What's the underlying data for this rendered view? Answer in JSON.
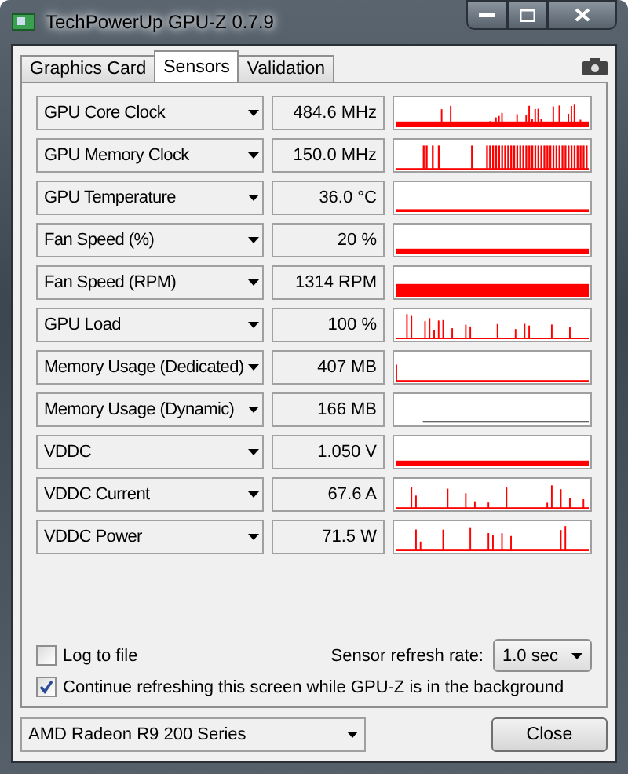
{
  "window": {
    "title": "TechPowerUp GPU-Z 0.7.9"
  },
  "tabs": [
    {
      "label": "Graphics Card",
      "selected": false
    },
    {
      "label": "Sensors",
      "selected": true
    },
    {
      "label": "Validation",
      "selected": false
    }
  ],
  "sensors": [
    {
      "name": "GPU Core Clock",
      "value": "484.6 MHz"
    },
    {
      "name": "GPU Memory Clock",
      "value": "150.0 MHz"
    },
    {
      "name": "GPU Temperature",
      "value": "36.0 °C"
    },
    {
      "name": "Fan Speed (%)",
      "value": "20 %"
    },
    {
      "name": "Fan Speed (RPM)",
      "value": "1314 RPM"
    },
    {
      "name": "GPU Load",
      "value": "100 %"
    },
    {
      "name": "Memory Usage (Dedicated)",
      "value": "407 MB"
    },
    {
      "name": "Memory Usage (Dynamic)",
      "value": "166 MB"
    },
    {
      "name": "VDDC",
      "value": "1.050 V"
    },
    {
      "name": "VDDC Current",
      "value": "67.6 A"
    },
    {
      "name": "VDDC Power",
      "value": "71.5 W"
    }
  ],
  "log_to_file": {
    "label": "Log to file",
    "checked": false
  },
  "refresh": {
    "label": "Sensor refresh rate:",
    "value": "1.0 sec"
  },
  "background_refresh": {
    "label": "Continue refreshing this screen while GPU-Z is in the background",
    "checked": true
  },
  "gpu_select": {
    "value": "AMD Radeon R9 200 Series"
  },
  "close_button": "Close"
}
